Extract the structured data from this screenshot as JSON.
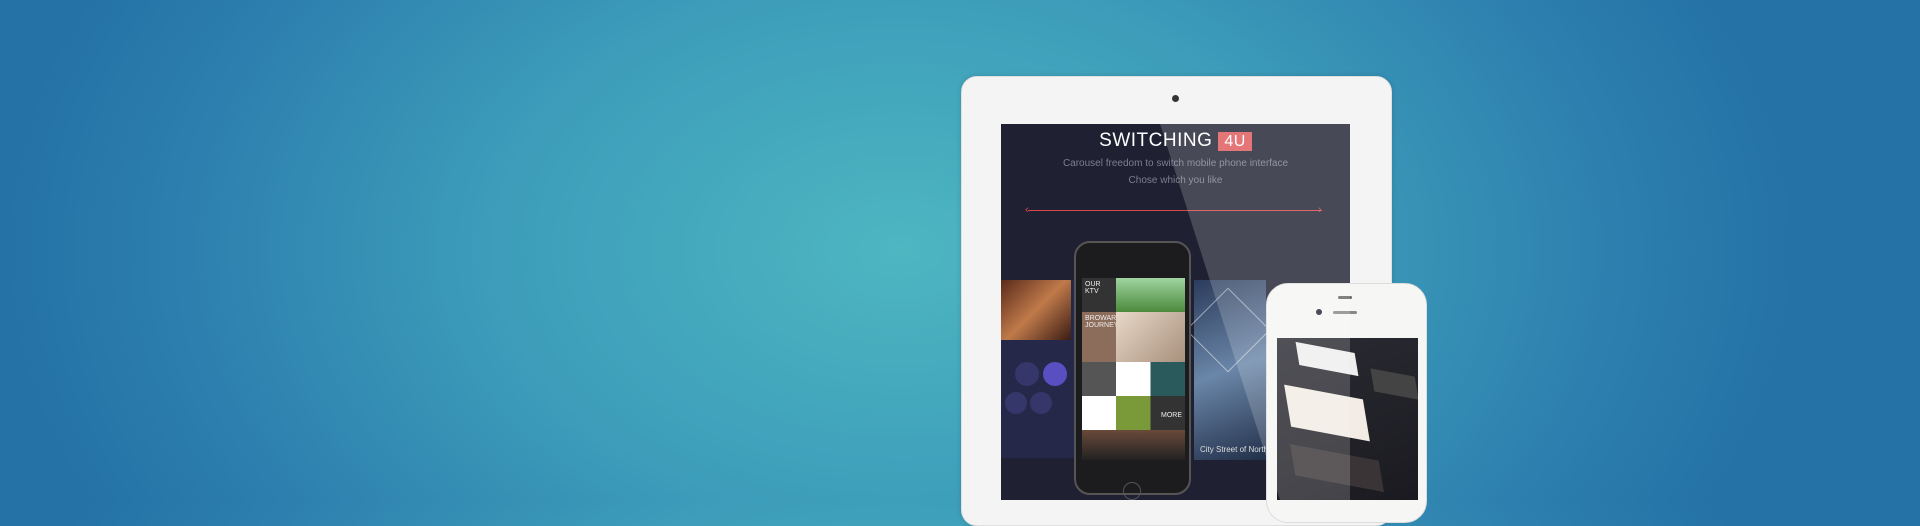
{
  "hero": {
    "title": "SWITCHING",
    "badge": "4U",
    "subtitle_1": "Carousel freedom to switch mobile phone interface",
    "subtitle_2": "Chose  which  you  like",
    "accent_color": "#e0585b"
  },
  "phone_screen": {
    "tile_1": "OUR KTV",
    "tile_2": "BROWARD JOURNEY",
    "tile_3": "MORE"
  },
  "right_panel": {
    "caption": "City Street of North"
  }
}
